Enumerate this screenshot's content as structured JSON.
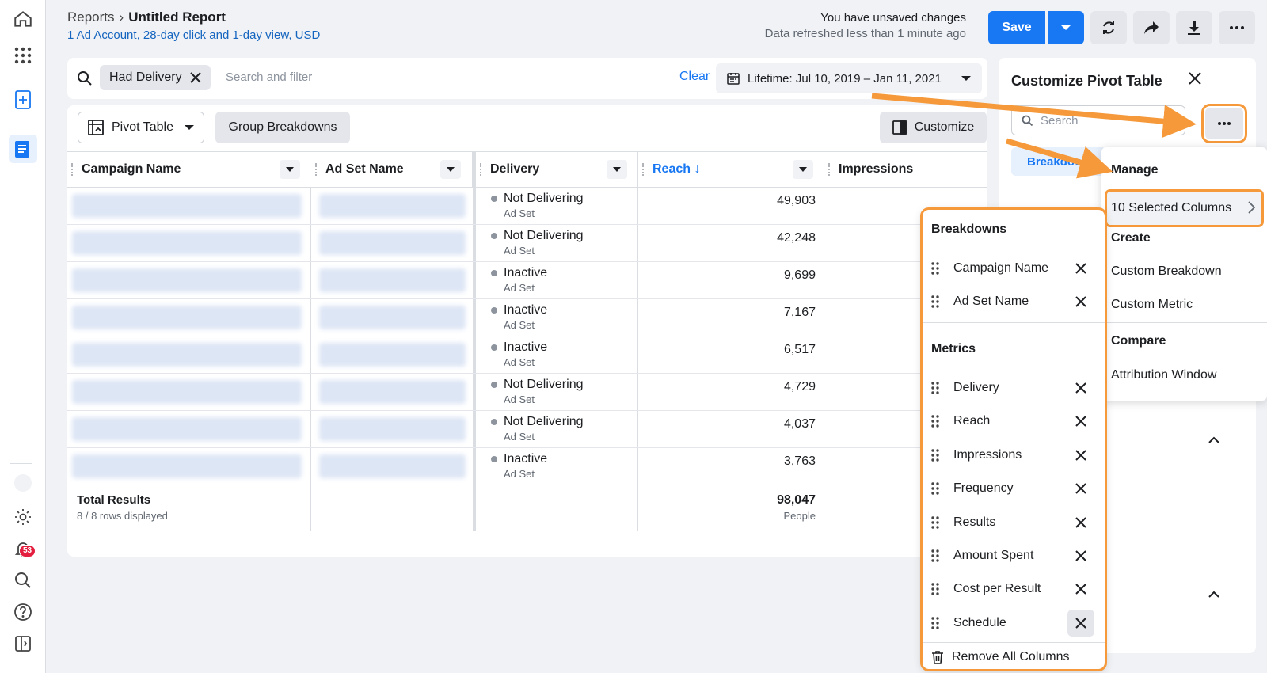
{
  "header": {
    "breadcrumb_root": "Reports",
    "title": "Untitled Report",
    "subtitle": "1 Ad Account, 28-day click and 1-day view, USD",
    "status_line1": "You have unsaved changes",
    "status_line2": "Data refreshed less than 1 minute ago",
    "save_label": "Save"
  },
  "filter": {
    "chip_label": "Had Delivery",
    "search_placeholder": "Search and filter",
    "clear_label": "Clear",
    "date_range": "Lifetime: Jul 10, 2019 – Jan 11, 2021"
  },
  "toolbar": {
    "pivot_label": "Pivot Table",
    "group_label": "Group Breakdowns",
    "customize_label": "Customize"
  },
  "table": {
    "columns": [
      "Campaign Name",
      "Ad Set Name",
      "Delivery",
      "Reach ↓",
      "Impressions"
    ],
    "rows": [
      {
        "delivery": "Not Delivering",
        "level": "Ad Set",
        "reach": "49,903"
      },
      {
        "delivery": "Not Delivering",
        "level": "Ad Set",
        "reach": "42,248"
      },
      {
        "delivery": "Inactive",
        "level": "Ad Set",
        "reach": "9,699"
      },
      {
        "delivery": "Inactive",
        "level": "Ad Set",
        "reach": "7,167"
      },
      {
        "delivery": "Inactive",
        "level": "Ad Set",
        "reach": "6,517"
      },
      {
        "delivery": "Not Delivering",
        "level": "Ad Set",
        "reach": "4,729"
      },
      {
        "delivery": "Not Delivering",
        "level": "Ad Set",
        "reach": "4,037"
      },
      {
        "delivery": "Inactive",
        "level": "Ad Set",
        "reach": "3,763"
      }
    ],
    "total_label": "Total Results",
    "total_sub": "8 / 8 rows displayed",
    "total_reach": "98,047",
    "total_reach_unit": "People"
  },
  "side_panel": {
    "title": "Customize Pivot Table",
    "search_placeholder": "Search",
    "tab_label": "Breakdowns"
  },
  "manage_menu": {
    "manage_header": "Manage",
    "selected_columns": "10 Selected Columns",
    "create_header": "Create",
    "custom_breakdown": "Custom Breakdown",
    "custom_metric": "Custom Metric",
    "compare_header": "Compare",
    "attribution_window": "Attribution Window"
  },
  "columns_menu": {
    "breakdowns_header": "Breakdowns",
    "breakdowns": [
      "Campaign Name",
      "Ad Set Name"
    ],
    "metrics_header": "Metrics",
    "metrics": [
      "Delivery",
      "Reach",
      "Impressions",
      "Frequency",
      "Results",
      "Amount Spent",
      "Cost per Result",
      "Schedule"
    ],
    "remove_all": "Remove All Columns"
  },
  "nav": {
    "notification_count": "53"
  },
  "colors": {
    "primary": "#1877f2",
    "highlight": "#f5993a",
    "badge": "#e41e3f"
  }
}
